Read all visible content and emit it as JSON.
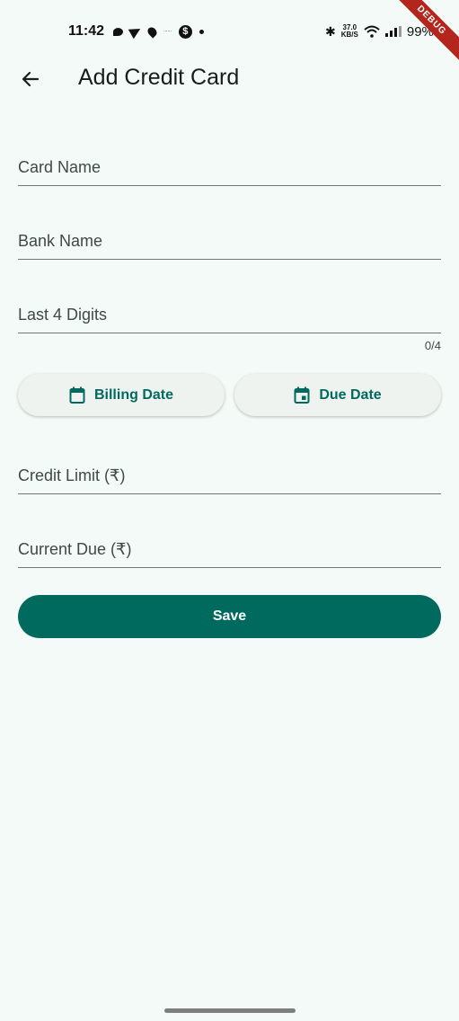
{
  "status_bar": {
    "time": "11:42",
    "mini_text": "······",
    "dollar": "$",
    "bluetooth": "✱",
    "speed_value": "37.0",
    "speed_unit": "KB/S",
    "wifi": "◔",
    "battery": "99%"
  },
  "debug_banner": "DEBUG",
  "app_bar": {
    "title": "Add Credit Card",
    "back_icon": "arrow-back-icon"
  },
  "form": {
    "card_name_placeholder": "Card Name",
    "bank_name_placeholder": "Bank Name",
    "last4_placeholder": "Last 4 Digits",
    "last4_counter": "0/4",
    "billing_date_label": "Billing Date",
    "due_date_label": "Due Date",
    "credit_limit_placeholder": "Credit Limit (₹)",
    "current_due_placeholder": "Current Due (₹)",
    "save_label": "Save"
  },
  "colors": {
    "primary": "#006a5f",
    "background": "#f4faf7",
    "debug": "#b3261e"
  }
}
